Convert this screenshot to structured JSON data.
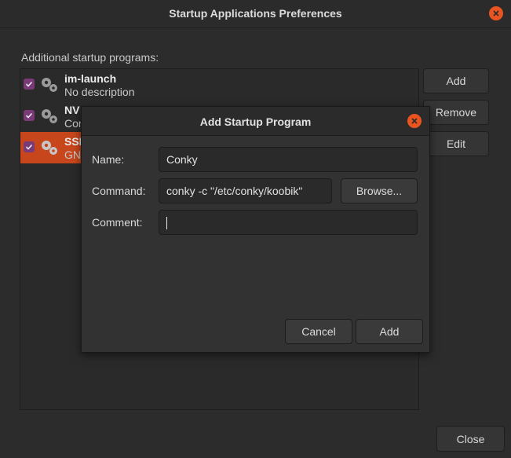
{
  "window": {
    "title": "Startup Applications Preferences",
    "section_label": "Additional startup programs:",
    "close_label": "Close"
  },
  "programs": [
    {
      "name": "im-launch",
      "description": "No description",
      "checked": true,
      "selected": false
    },
    {
      "name": "NV",
      "description": "Cor",
      "checked": true,
      "selected": false
    },
    {
      "name": "SSI",
      "description": "GN",
      "checked": true,
      "selected": true
    }
  ],
  "side_buttons": {
    "add": "Add",
    "remove": "Remove",
    "edit": "Edit"
  },
  "dialog": {
    "title": "Add Startup Program",
    "name_label": "Name:",
    "name_value": "Conky",
    "command_label": "Command:",
    "command_value": "conky -c \"/etc/conky/koobik\"",
    "comment_label": "Comment:",
    "comment_value": "",
    "browse_label": "Browse...",
    "cancel_label": "Cancel",
    "add_label": "Add"
  },
  "colors": {
    "accent": "#e95420",
    "selection": "#c8461b",
    "checkbox": "#7a3a78"
  }
}
